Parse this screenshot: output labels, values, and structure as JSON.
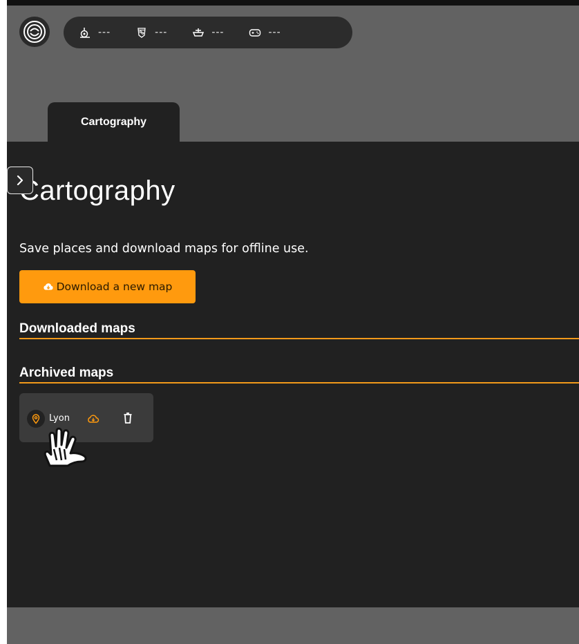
{
  "statusbar": {
    "items": [
      {
        "icon": "gps-satellite-icon",
        "value": "---"
      },
      {
        "icon": "map-badge-icon",
        "value": "---"
      },
      {
        "icon": "boat-icon",
        "value": "---"
      },
      {
        "icon": "gamepad-icon",
        "value": "---"
      }
    ]
  },
  "tab": {
    "label": "Cartography"
  },
  "page": {
    "title": "Cartography",
    "subtitle": "Save places and download maps for offline use.",
    "download_button": "Download a new map"
  },
  "sections": {
    "downloaded": "Downloaded maps",
    "archived": "Archived maps"
  },
  "archived_maps": [
    {
      "name": "Lyon"
    }
  ],
  "colors": {
    "accent": "#ff9a0e",
    "panel": "#212121",
    "background": "#626262",
    "card": "#3b3b3b"
  }
}
